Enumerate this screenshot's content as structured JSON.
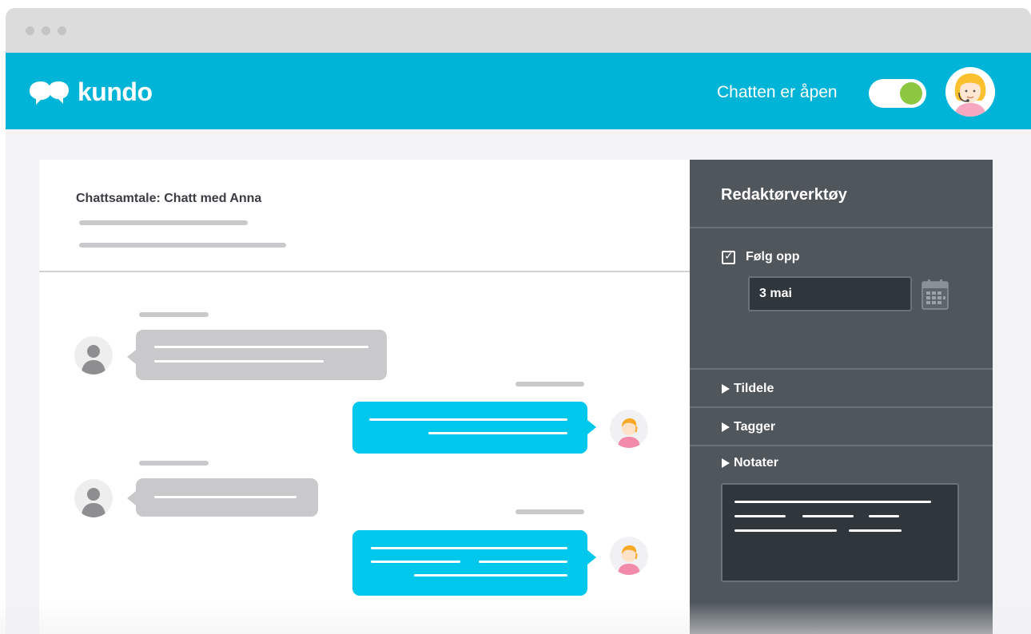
{
  "header": {
    "logo_text": "kundo",
    "chat_status": "Chatten er åpen",
    "toggle_on": true
  },
  "conversation": {
    "title": "Chattsamtale: Chatt med Anna"
  },
  "editor": {
    "title": "Redaktørverktøy",
    "follow_up_label": "Følg opp",
    "follow_up_checked": true,
    "checkmark": "✓",
    "date_value": "3 mai",
    "sections": {
      "assign": "Tildele",
      "tags": "Tagger",
      "notes": "Notater"
    }
  },
  "colors": {
    "brand": "#00b4d8",
    "outgoing_bubble": "#00c8ec",
    "incoming_bubble": "#c9c9cb",
    "toggle_knob": "#8dc641",
    "sidebar": "#4f565c"
  }
}
